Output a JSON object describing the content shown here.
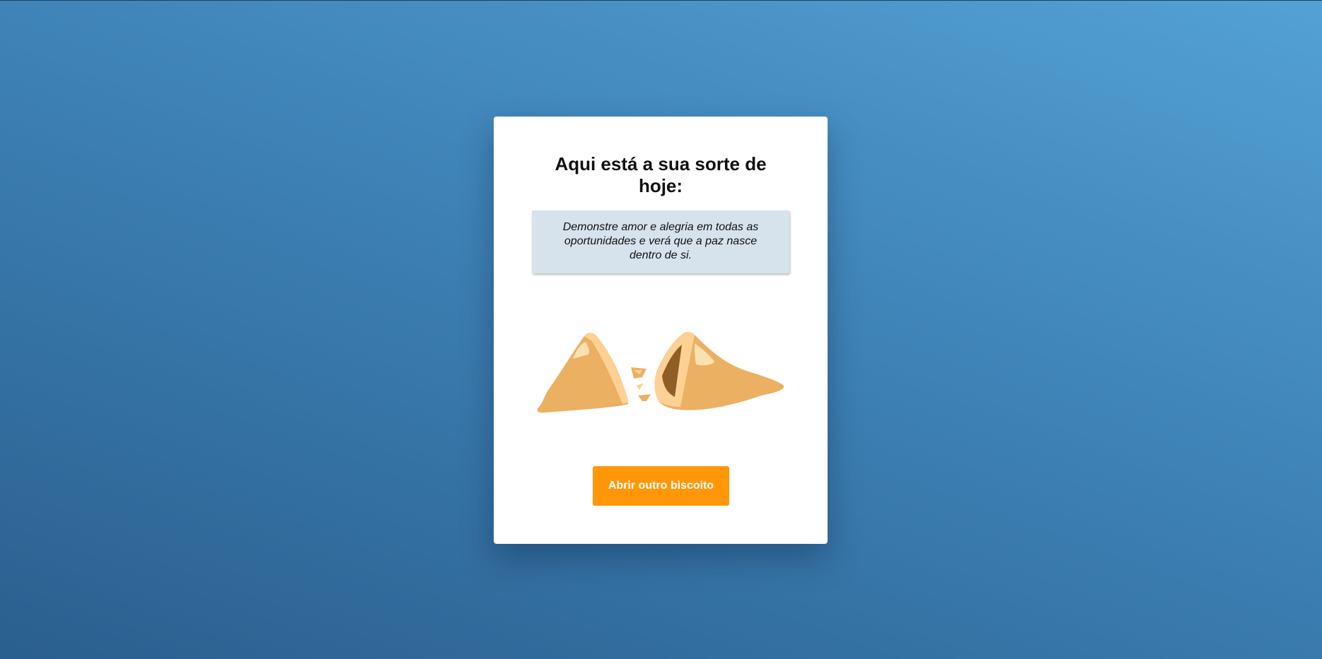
{
  "card": {
    "title": "Aqui está a sua sorte de hoje:",
    "fortune": "Demonstre amor e alegria em todas as oportunidades e verá que a paz nasce dentro de si.",
    "cookie_icon": "broken-fortune-cookie",
    "button_label": "Abrir outro biscoito"
  },
  "colors": {
    "background_top": "#53a1d5",
    "background_bottom": "#2a5f8f",
    "card": "#ffffff",
    "fortune_box": "#d6e3ec",
    "button": "#ff9709",
    "cookie_main": "#ebb061",
    "cookie_light": "#fdd193",
    "cookie_dark": "#8f5e24"
  }
}
